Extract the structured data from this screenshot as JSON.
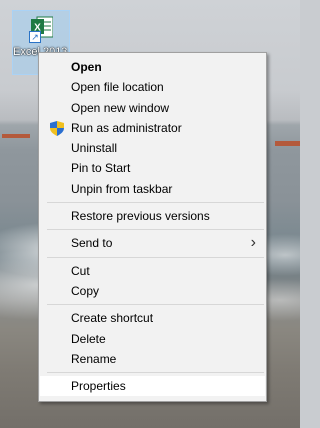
{
  "desktop": {
    "icon": {
      "label": "Excel 2013 Shortcut",
      "icon_name": "excel-icon",
      "brand_color": "#1f7a44",
      "selected": true
    }
  },
  "context_menu": {
    "groups": [
      [
        {
          "label": "Open",
          "bold": true
        },
        {
          "label": "Open file location"
        },
        {
          "label": "Open new window"
        },
        {
          "label": "Run as administrator",
          "icon": "uac-shield-icon"
        },
        {
          "label": "Uninstall"
        },
        {
          "label": "Pin to Start"
        },
        {
          "label": "Unpin from taskbar"
        }
      ],
      [
        {
          "label": "Restore previous versions"
        }
      ],
      [
        {
          "label": "Send to",
          "submenu": true,
          "submenu_icon": "chevron-right-icon"
        }
      ],
      [
        {
          "label": "Cut"
        },
        {
          "label": "Copy"
        }
      ],
      [
        {
          "label": "Create shortcut"
        },
        {
          "label": "Delete"
        },
        {
          "label": "Rename"
        }
      ],
      [
        {
          "label": "Properties",
          "highlighted": true
        }
      ]
    ],
    "colors": {
      "background": "#f2f2f2",
      "border": "#a0a0a0",
      "separator": "#d7d7d7",
      "highlight": "#ffffff"
    }
  }
}
